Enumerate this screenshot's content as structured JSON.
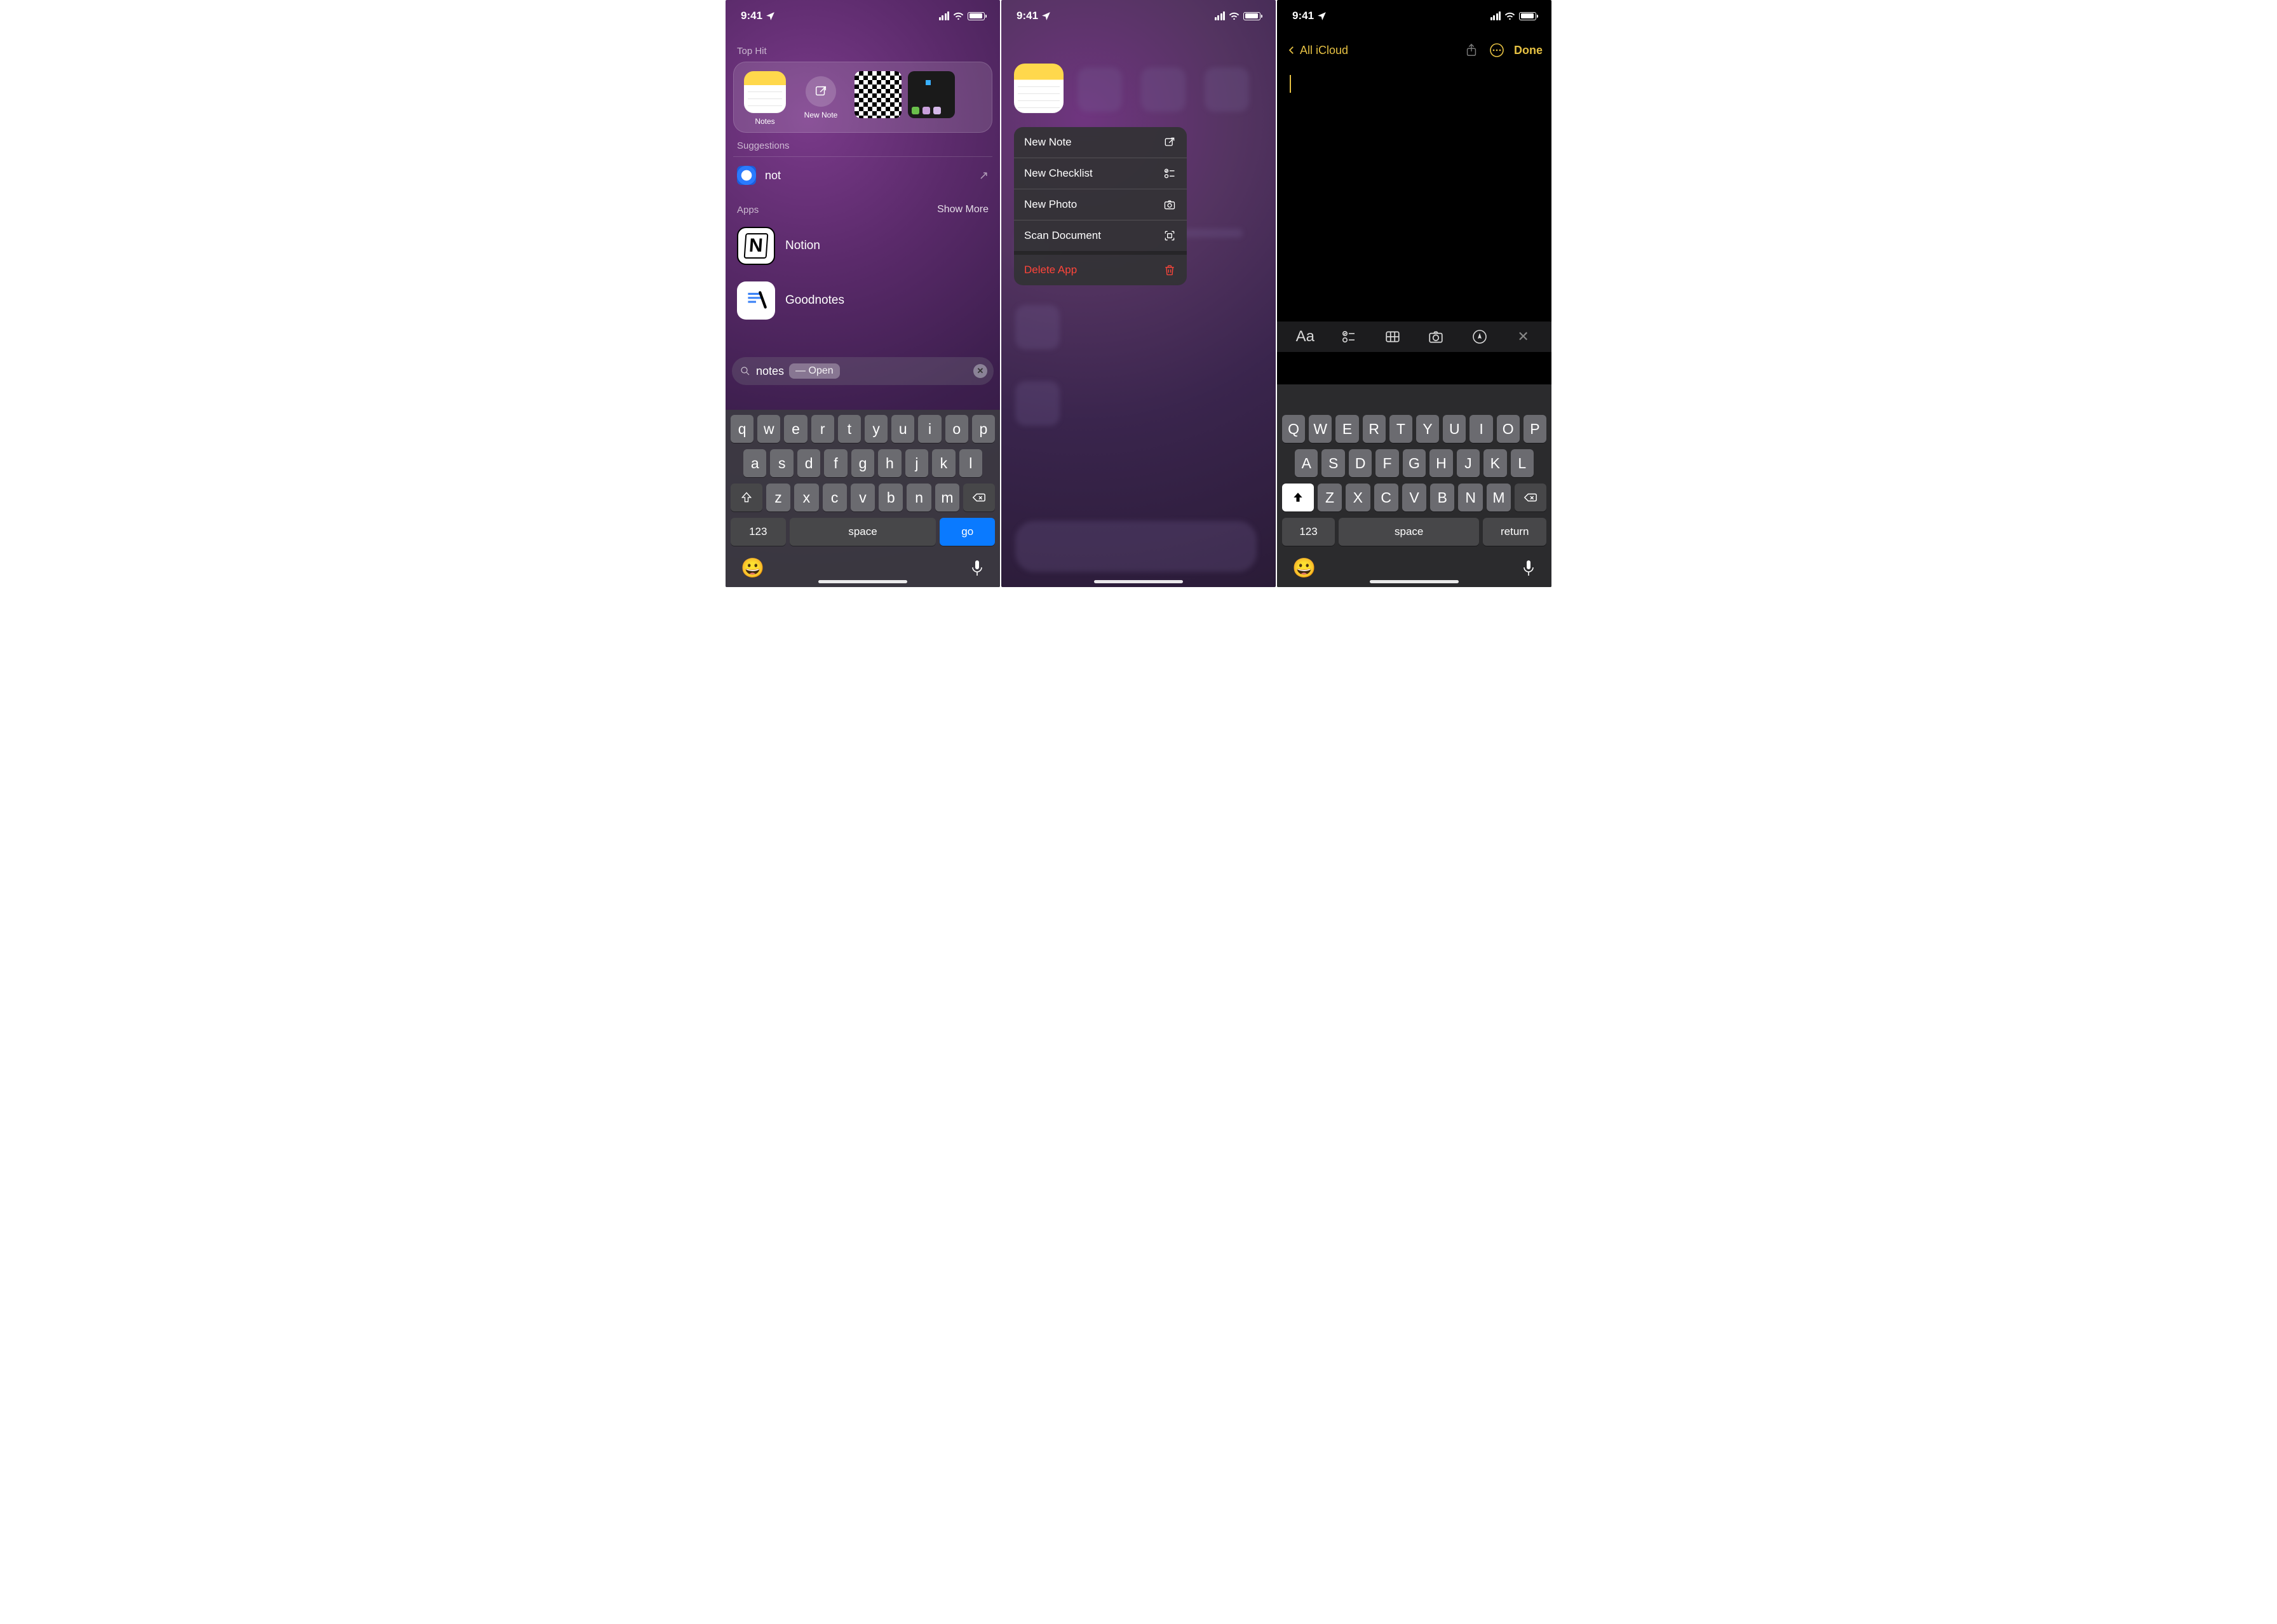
{
  "status": {
    "time": "9:41"
  },
  "screen1": {
    "top_hit_label": "Top Hit",
    "top_hit": {
      "app_label": "Notes",
      "new_note_label": "New Note"
    },
    "suggestions_label": "Suggestions",
    "web_suggestion": "not",
    "apps_label": "Apps",
    "show_more": "Show More",
    "apps": [
      {
        "name": "Notion"
      },
      {
        "name": "Goodnotes"
      }
    ],
    "search": {
      "query": "notes",
      "pill": "—  Open"
    },
    "keyboard": {
      "rows": [
        [
          "q",
          "w",
          "e",
          "r",
          "t",
          "y",
          "u",
          "i",
          "o",
          "p"
        ],
        [
          "a",
          "s",
          "d",
          "f",
          "g",
          "h",
          "j",
          "k",
          "l"
        ],
        [
          "z",
          "x",
          "c",
          "v",
          "b",
          "n",
          "m"
        ]
      ],
      "num": "123",
      "space": "space",
      "go": "go"
    }
  },
  "screen2": {
    "menu": [
      {
        "label": "New Note",
        "icon": "compose"
      },
      {
        "label": "New Checklist",
        "icon": "checklist"
      },
      {
        "label": "New Photo",
        "icon": "camera"
      },
      {
        "label": "Scan Document",
        "icon": "scan"
      },
      {
        "label": "Delete App",
        "icon": "trash",
        "danger": true,
        "sep": true
      }
    ]
  },
  "screen3": {
    "back": "All iCloud",
    "done": "Done",
    "keyboard": {
      "rows": [
        [
          "Q",
          "W",
          "E",
          "R",
          "T",
          "Y",
          "U",
          "I",
          "O",
          "P"
        ],
        [
          "A",
          "S",
          "D",
          "F",
          "G",
          "H",
          "J",
          "K",
          "L"
        ],
        [
          "Z",
          "X",
          "C",
          "V",
          "B",
          "N",
          "M"
        ]
      ],
      "num": "123",
      "space": "space",
      "return": "return"
    }
  }
}
